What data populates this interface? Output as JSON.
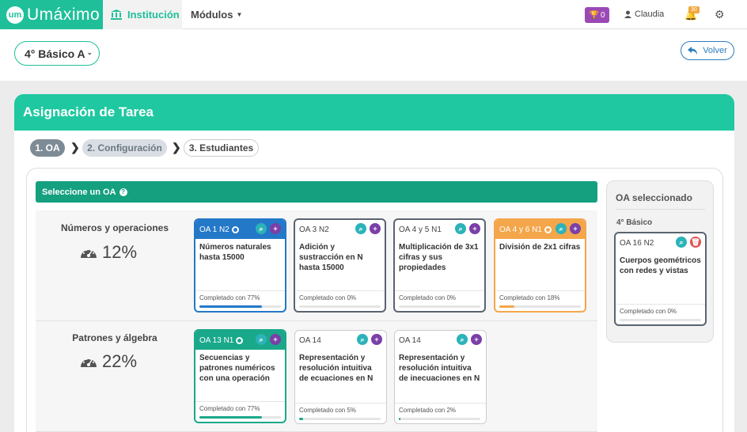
{
  "nav": {
    "brand_logo": "um",
    "brand_name": "Umáximo",
    "institucion": "Institución",
    "modulos": "Módulos",
    "trophy_count": "0",
    "user": "Claudia",
    "notif_count": "30"
  },
  "grade_select": "4° Básico A",
  "back_label": "Volver",
  "panel_title": "Asignación de Tarea",
  "steps": [
    "1. OA",
    "2. Configuración",
    "3. Estudiantes"
  ],
  "select_header": "Seleccione un OA",
  "rows": [
    {
      "title": "Números y operaciones",
      "percent": "12%",
      "cards": [
        {
          "code": "OA 1 N2",
          "desc": "Números naturales hasta 15000",
          "completed": "Completado con 77%",
          "progress": 0.77,
          "style": "blue"
        },
        {
          "code": "OA 3 N2",
          "desc": "Adición y sustracción en N hasta 15000",
          "completed": "Completado con 0%",
          "progress": 0.0,
          "style": "plain"
        },
        {
          "code": "OA 4 y 5 N1",
          "desc": "Multiplicación de 3x1 cifras y sus propiedades",
          "completed": "Completado con 0%",
          "progress": 0.0,
          "style": "plain"
        },
        {
          "code": "OA 4 y 6 N1",
          "desc": "División de 2x1 cifras",
          "completed": "Completado con 18%",
          "progress": 0.18,
          "style": "orange"
        }
      ]
    },
    {
      "title": "Patrones y álgebra",
      "percent": "22%",
      "cards": [
        {
          "code": "OA 13 N1",
          "desc": "Secuencias y patrones numéricos con una operación",
          "completed": "Completado con 77%",
          "progress": 0.77,
          "style": "green"
        },
        {
          "code": "OA 14",
          "desc": "Representación y resolución intuitiva de ecuaciones en N",
          "completed": "Completado con 5%",
          "progress": 0.05,
          "style": "thin"
        },
        {
          "code": "OA 14",
          "desc": "Representación y resolución intuitiva de inecuaciones en N",
          "completed": "Completado con 2%",
          "progress": 0.02,
          "style": "thin"
        }
      ]
    }
  ],
  "selected": {
    "title": "OA seleccionado",
    "grade": "4° Básico",
    "card": {
      "code": "OA 16 N2",
      "desc": "Cuerpos geométricos con redes y vistas",
      "completed": "Completado con 0%",
      "progress": 0.0
    }
  },
  "colors": {
    "accent": "#1fc8a0",
    "blue": "#2478c8",
    "orange": "#f4a64b",
    "purple": "#7b3fa8",
    "teal": "#2bb3b8"
  }
}
